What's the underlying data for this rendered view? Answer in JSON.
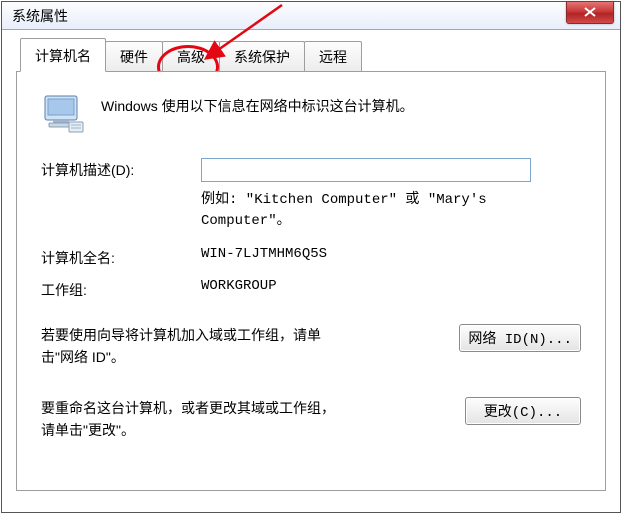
{
  "window": {
    "title": "系统属性"
  },
  "tabs": [
    {
      "label": "计算机名"
    },
    {
      "label": "硬件"
    },
    {
      "label": "高级"
    },
    {
      "label": "系统保护"
    },
    {
      "label": "远程"
    }
  ],
  "body": {
    "intro": "Windows 使用以下信息在网络中标识这台计算机。",
    "desc_label": "计算机描述(D):",
    "desc_value": "",
    "hint_line1": "例如: \"Kitchen Computer\" 或 \"Mary's",
    "hint_line2": "Computer\"。",
    "fullname_label": "计算机全名:",
    "fullname_value": "WIN-7LJTMHM6Q5S",
    "workgroup_label": "工作组:",
    "workgroup_value": "WORKGROUP",
    "network_text_line1": "若要使用向导将计算机加入域或工作组，请单",
    "network_text_line2": "击\"网络 ID\"。",
    "network_btn": "网络 ID(N)...",
    "change_text_line1": "要重命名这台计算机，或者更改其域或工作组，",
    "change_text_line2": "请单击\"更改\"。",
    "change_btn": "更改(C)..."
  }
}
